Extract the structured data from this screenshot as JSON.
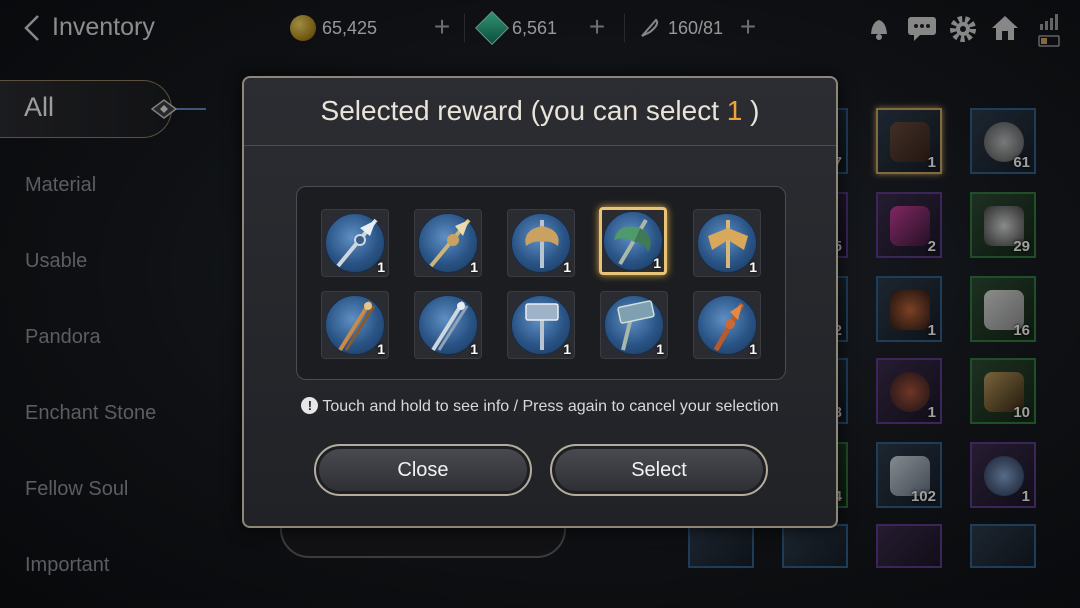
{
  "header": {
    "title": "Inventory",
    "currencies": [
      {
        "icon": "gold-coin-icon",
        "value": "65,425"
      },
      {
        "icon": "gem-icon",
        "value": "6,561"
      },
      {
        "icon": "feather-icon",
        "value": "160/81"
      }
    ],
    "icons": [
      "bell-icon",
      "chat-icon",
      "gear-icon",
      "home-icon",
      "signal-battery-icon"
    ]
  },
  "sidebar": {
    "active": "All",
    "items": [
      "Material",
      "Usable",
      "Pandora",
      "Enchant Stone",
      "Fellow Soul",
      "Important"
    ]
  },
  "inventory": {
    "counts": [
      "7",
      "1",
      "61",
      "5",
      "2",
      "29",
      "2",
      "1",
      "16",
      "3",
      "1",
      "10",
      "4",
      "102",
      "1"
    ]
  },
  "modal": {
    "title_prefix": "Selected reward (you can select ",
    "title_count": "1",
    "title_suffix": " )",
    "rewards": [
      {
        "icon": "spear-icon",
        "count": "1",
        "selected": false
      },
      {
        "icon": "spear-icon",
        "count": "1",
        "selected": false
      },
      {
        "icon": "axe-icon",
        "count": "1",
        "selected": false
      },
      {
        "icon": "axe-icon",
        "count": "1",
        "selected": true
      },
      {
        "icon": "axe-icon",
        "count": "1",
        "selected": false
      },
      {
        "icon": "staff-icon",
        "count": "1",
        "selected": false
      },
      {
        "icon": "staff-icon",
        "count": "1",
        "selected": false
      },
      {
        "icon": "hammer-icon",
        "count": "1",
        "selected": false
      },
      {
        "icon": "hammer-icon",
        "count": "1",
        "selected": false
      },
      {
        "icon": "spear-icon",
        "count": "1",
        "selected": false
      }
    ],
    "hint": "Touch and hold to see info / Press again to cancel your selection",
    "close_label": "Close",
    "select_label": "Select"
  },
  "colors": {
    "accent": "#f2a23a",
    "selected_border": "#e9c477"
  }
}
